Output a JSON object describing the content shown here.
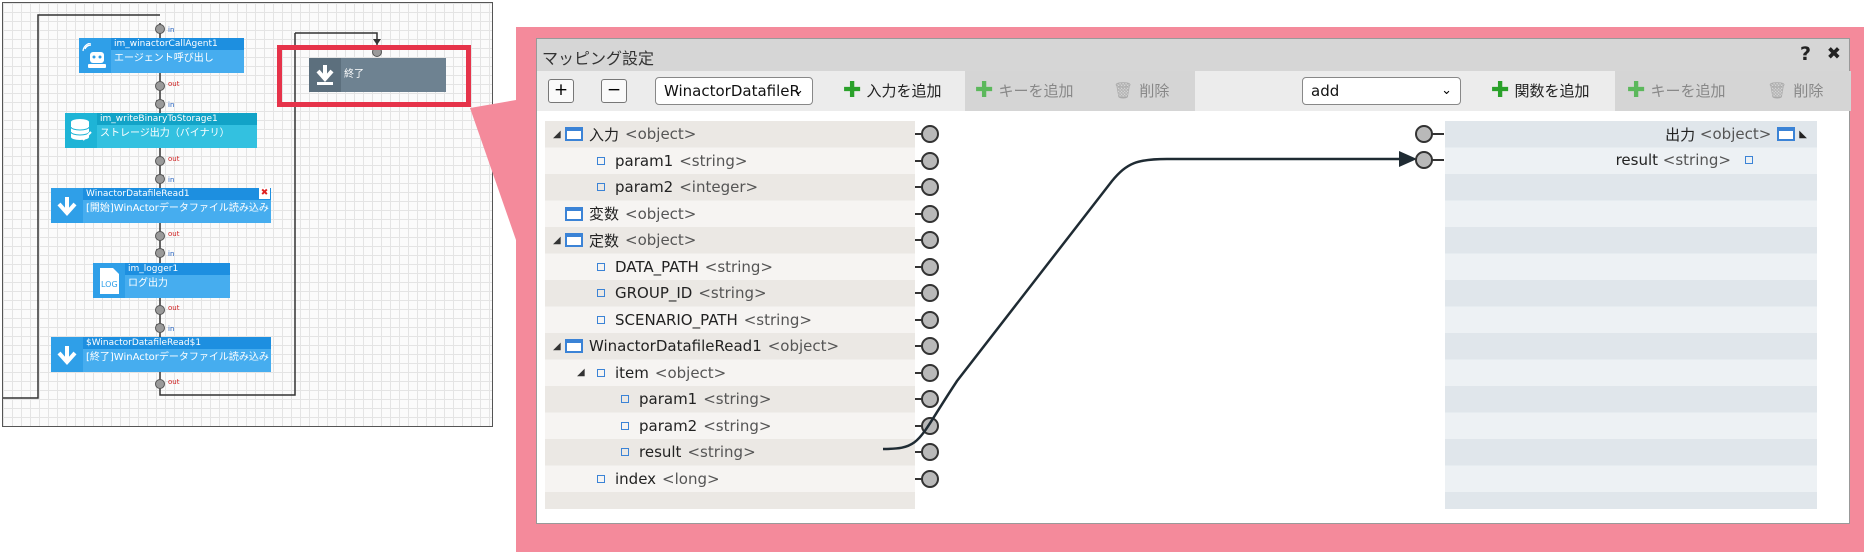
{
  "flow": {
    "nodes": [
      {
        "header": "im_winactorCallAgent1",
        "label": "エージェント呼び出し",
        "icon": "robot-agent-icon",
        "color": "#2f9fe8"
      },
      {
        "header": "im_writeBinaryToStorage1",
        "label": "ストレージ出力（バイナリ）",
        "icon": "storage-database-icon",
        "color": "#1eb4d6"
      },
      {
        "header": "WinactorDatafileRead1",
        "label": "[開始]WinActorデータファイル読み込み",
        "icon": "down-arrow-icon",
        "color": "#2f9fe8"
      },
      {
        "header": "im_logger1",
        "label": "ログ出力",
        "icon": "log-icon",
        "color": "#2f9fe8"
      },
      {
        "header": "$WinactorDatafileRead$1",
        "label": "[終了]WinActorデータファイル読み込み",
        "icon": "down-arrow-icon",
        "color": "#2f9fe8"
      }
    ],
    "end_node": {
      "label": "終了",
      "color": "#6e8291"
    },
    "port_in": "in",
    "port_out": "out",
    "delete_mark": "✖"
  },
  "dialog": {
    "title": "マッピング設定",
    "help": "?",
    "close": "✖",
    "toolbar": {
      "expand": "+",
      "collapse": "−",
      "input_select": "WinactorDatafileR",
      "add_input": "入力を追加",
      "add_key_left": "キーを追加",
      "delete_left": "削除",
      "function_select": "add",
      "add_function": "関数を追加",
      "add_key_right": "キーを追加",
      "delete_right": "削除"
    },
    "left_tree": [
      {
        "depth": 0,
        "toggle": "◢",
        "kind": "object",
        "name": "入力",
        "type": "<object>"
      },
      {
        "depth": 1,
        "toggle": "",
        "kind": "leaf",
        "name": "param1",
        "type": "<string>"
      },
      {
        "depth": 1,
        "toggle": "",
        "kind": "leaf",
        "name": "param2",
        "type": "<integer>"
      },
      {
        "depth": 0,
        "toggle": "",
        "kind": "object",
        "name": "変数",
        "type": "<object>"
      },
      {
        "depth": 0,
        "toggle": "◢",
        "kind": "object",
        "name": "定数",
        "type": "<object>"
      },
      {
        "depth": 1,
        "toggle": "",
        "kind": "leaf",
        "name": "DATA_PATH",
        "type": "<string>"
      },
      {
        "depth": 1,
        "toggle": "",
        "kind": "leaf",
        "name": "GROUP_ID",
        "type": "<string>"
      },
      {
        "depth": 1,
        "toggle": "",
        "kind": "leaf",
        "name": "SCENARIO_PATH",
        "type": "<string>"
      },
      {
        "depth": 0,
        "toggle": "◢",
        "kind": "object",
        "name": "WinactorDatafileRead1",
        "type": "<object>"
      },
      {
        "depth": 1,
        "toggle": "◢",
        "kind": "leaf",
        "name": "item",
        "type": "<object>"
      },
      {
        "depth": 2,
        "toggle": "",
        "kind": "leaf",
        "name": "param1",
        "type": "<string>"
      },
      {
        "depth": 2,
        "toggle": "",
        "kind": "leaf",
        "name": "param2",
        "type": "<string>"
      },
      {
        "depth": 2,
        "toggle": "",
        "kind": "leaf",
        "name": "result",
        "type": "<string>"
      },
      {
        "depth": 1,
        "toggle": "",
        "kind": "leaf",
        "name": "index",
        "type": "<long>"
      }
    ],
    "right_tree": [
      {
        "name": "出力",
        "type": "<object>",
        "toggle": "◣"
      },
      {
        "name": "result",
        "type": "<string>"
      }
    ],
    "mapping": {
      "from": "result",
      "to": "result"
    }
  }
}
